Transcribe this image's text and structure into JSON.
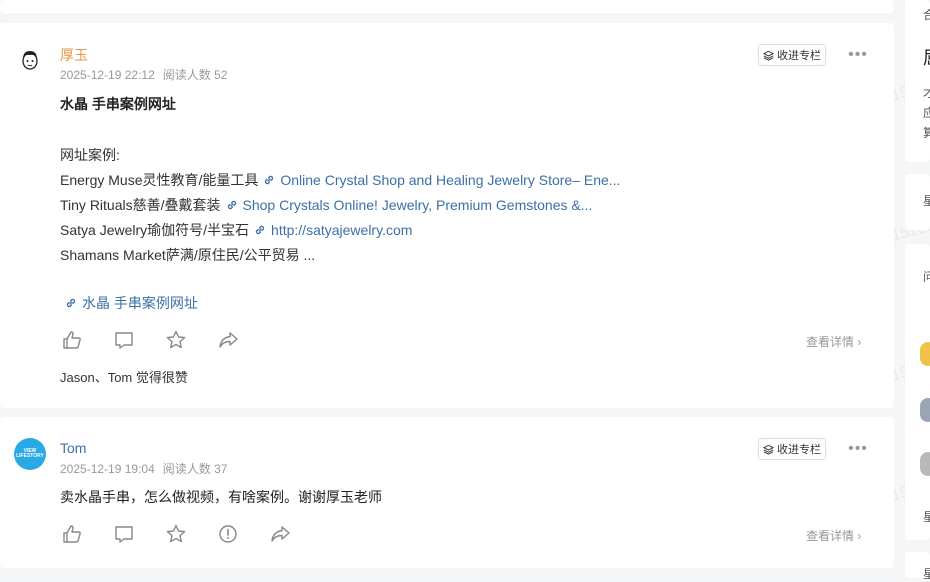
{
  "posts": [
    {
      "author": "厚玉",
      "author_color": "#e6994a",
      "date": "2025-12-19 22:12",
      "views": "阅读人数 52",
      "collect_label": "收进专栏",
      "title": "水晶 手串案例网址",
      "lines": [
        {
          "text": "网址案例:",
          "link": ""
        },
        {
          "text": "Energy Muse灵性教育/能量工具",
          "link": "Online Crystal Shop and Healing Jewelry Store– Ene..."
        },
        {
          "text": "Tiny Rituals慈善/叠戴套装",
          "link": "Shop Crystals Online! Jewelry, Premium Gemstones &..."
        },
        {
          "text": "Satya Jewelry瑜伽符号/半宝石",
          "link": "http://satyajewelry.com"
        },
        {
          "text": "Shamans Market萨满/原住民/公平贸易 ...",
          "link": ""
        }
      ],
      "bottom_link": "水晶 手串案例网址",
      "detail_label": "查看详情",
      "likers": "Jason、Tom 觉得很赞"
    },
    {
      "author": "Tom",
      "author_color": "#3d6fa8",
      "date": "2025-12-19 19:04",
      "views": "阅读人数 37",
      "collect_label": "收进专栏",
      "text": "卖水晶手串，怎么做视频，有啥案例。谢谢厚玉老师",
      "detail_label": "查看详情",
      "avatar_text": "VIEW LIFESTORY"
    }
  ],
  "watermark": "厚玉 54811518885484",
  "sidebar": {
    "partial_chars": [
      "合",
      "屈",
      "才",
      "应",
      "算",
      "星",
      "问",
      "星",
      "星"
    ]
  },
  "icons": [
    "like-icon",
    "comment-icon",
    "star-icon",
    "share-icon",
    "report-icon",
    "link-icon",
    "more-icon",
    "collect-icon"
  ]
}
